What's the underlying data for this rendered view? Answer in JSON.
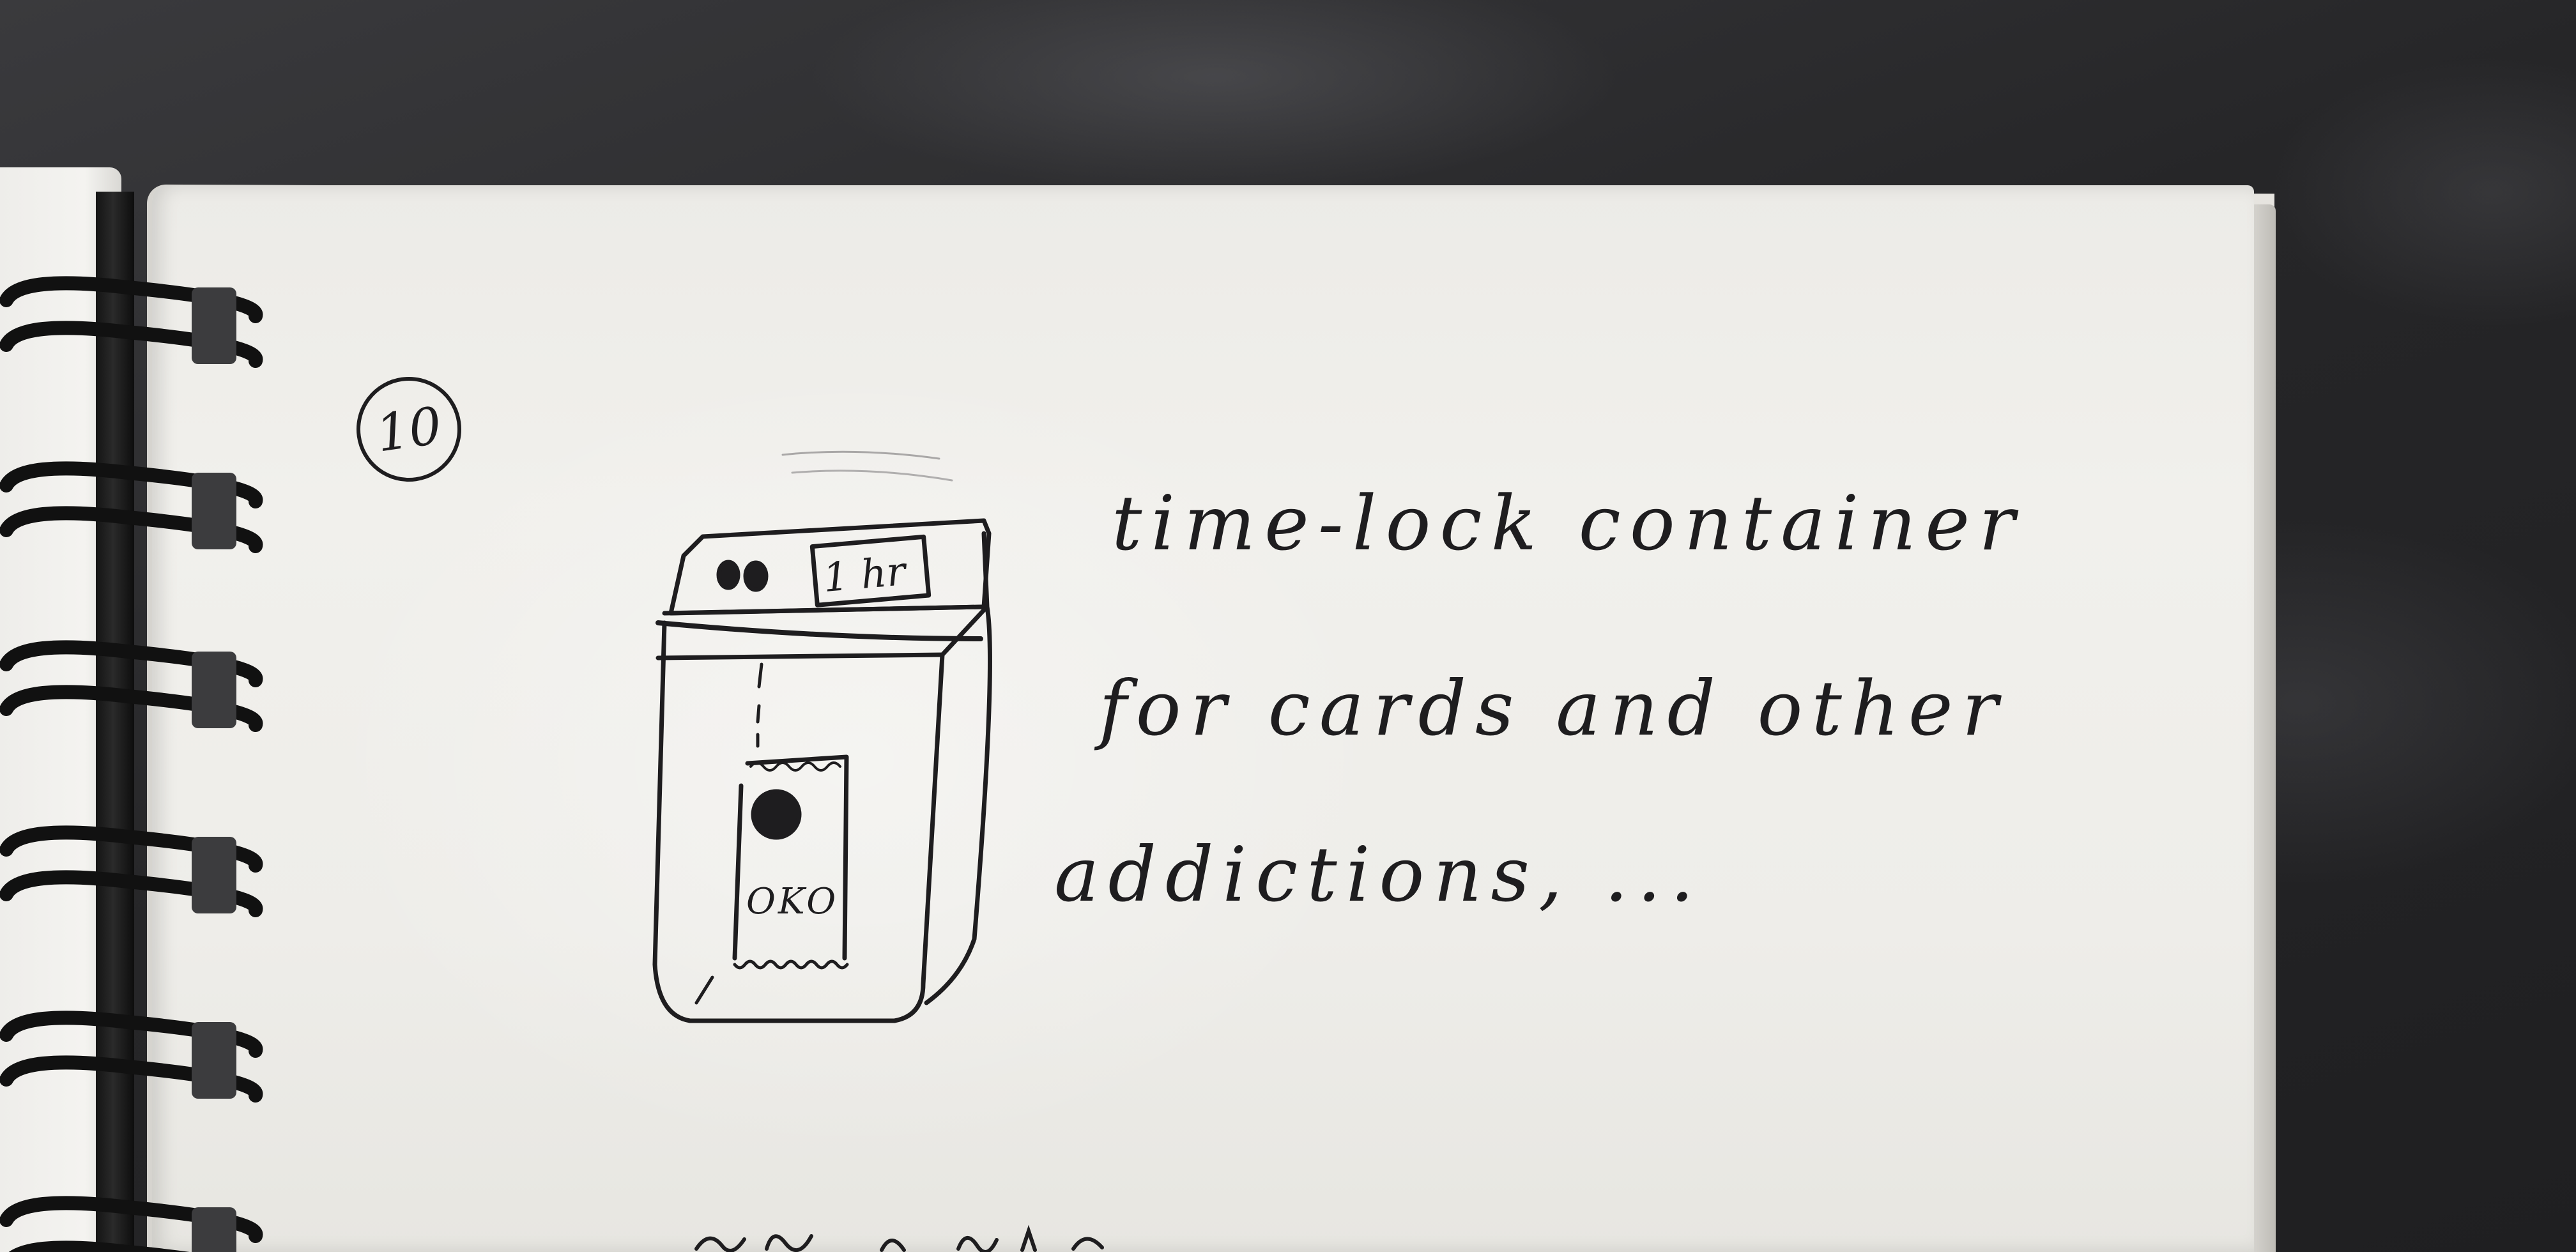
{
  "photo": {
    "subject": "Spiral sketchbook page with a hand-drawn sketch and handwritten note",
    "background_color": "#2b2b2d",
    "paper_color": "#eeede9",
    "ink_color": "#1e1d1f"
  },
  "notebook": {
    "page_number": "10",
    "sketch": {
      "timer_label": "1 hr",
      "card_label": "OKO"
    },
    "note_lines": [
      "time-lock container",
      "for cards and other",
      "addictions, ..."
    ]
  }
}
